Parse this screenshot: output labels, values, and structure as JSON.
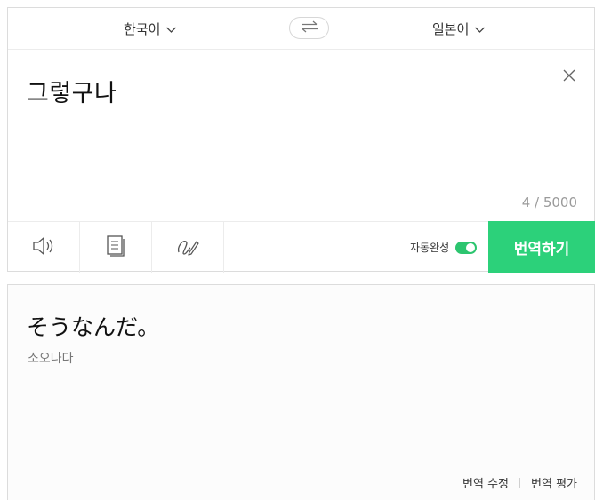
{
  "languages": {
    "source": "한국어",
    "target": "일본어"
  },
  "source": {
    "text": "그렇구나",
    "counter": "4 / 5000"
  },
  "toolbar": {
    "autocomplete_label": "자동완성",
    "autocomplete_on": true,
    "translate_label": "번역하기"
  },
  "output": {
    "text": "そうなんだ。",
    "pronunciation": "소오나다",
    "edit_label": "번역 수정",
    "rate_label": "번역 평가"
  },
  "colors": {
    "accent": "#2cd17a",
    "toggle": "#2cc56f"
  },
  "icons": [
    "chevron-down-icon",
    "swap-icon",
    "close-icon",
    "speaker-icon",
    "copy-icon",
    "handwriting-icon"
  ]
}
